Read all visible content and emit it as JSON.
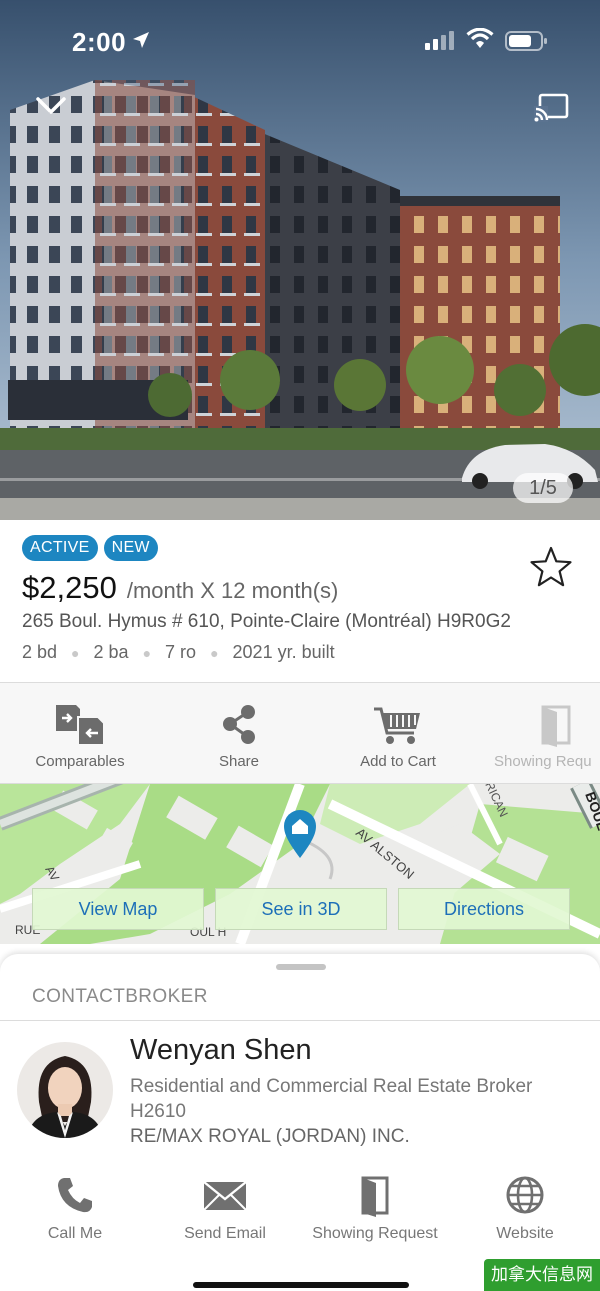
{
  "status_bar": {
    "time": "2:00"
  },
  "hero": {
    "photo_counter": "1/5"
  },
  "listing": {
    "badges": [
      "ACTIVE",
      "NEW"
    ],
    "price": "$2,250",
    "price_suffix": "/month X 12 month(s)",
    "address": "265 Boul. Hymus # 610, Pointe-Claire (Montréal)  H9R0G2",
    "stats": [
      "2 bd",
      "2 ba",
      "7 ro",
      "2021 yr. built"
    ]
  },
  "actions": [
    {
      "label": "Comparables",
      "icon": "comparables-icon"
    },
    {
      "label": "Share",
      "icon": "share-icon"
    },
    {
      "label": "Add to Cart",
      "icon": "cart-icon"
    },
    {
      "label": "Showing Requ",
      "icon": "door-icon"
    }
  ],
  "map": {
    "street_labels": [
      "AV ALSTON",
      "BOUL",
      "AV",
      "RUE",
      "RICAN",
      "OUL H"
    ],
    "buttons": [
      "View Map",
      "See in 3D",
      "Directions"
    ]
  },
  "contact": {
    "title": "CONTACTBROKER",
    "broker_name": "Wenyan Shen",
    "broker_title": "Residential and Commercial Real Estate Broker H2610",
    "agency": "RE/MAX ROYAL (JORDAN) INC.",
    "actions": [
      {
        "label": "Call Me",
        "icon": "phone-icon"
      },
      {
        "label": "Send Email",
        "icon": "email-icon"
      },
      {
        "label": "Showing Request",
        "icon": "door-icon"
      },
      {
        "label": "Website",
        "icon": "globe-icon"
      }
    ]
  },
  "watermark": "加拿大信息网",
  "colors": {
    "accent": "#1d86c1",
    "map_button_text": "#1d6fb8",
    "watermark": "#2f9e2f"
  }
}
